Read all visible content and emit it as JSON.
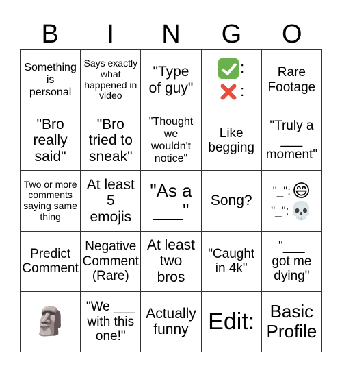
{
  "header": {
    "letters": [
      "B",
      "I",
      "N",
      "G",
      "O"
    ]
  },
  "board": {
    "rows": [
      [
        {
          "text": "Something\nis\npersonal"
        },
        {
          "text": "Says exactly\nwhat\nhappened in\nvideo"
        },
        {
          "text": "\"Type\nof guy\""
        },
        {
          "icons": [
            "check-mark-emoji",
            "cross-mark-emoji"
          ],
          "suffix": ":"
        },
        {
          "text": "Rare\nFootage"
        }
      ],
      [
        {
          "text": "\"Bro\nreally\nsaid\""
        },
        {
          "text": "\"Bro\ntried to\nsneak\""
        },
        {
          "text": "\"Thought\nwe\nwouldn't\nnotice\""
        },
        {
          "text": "Like\nbegging"
        },
        {
          "text": "\"Truly a\n___\nmoment\""
        }
      ],
      [
        {
          "text": "Two or more\ncomments\nsaying same\nthing"
        },
        {
          "text": "At least\n5\nemojis"
        },
        {
          "text": "\"As a\n___\""
        },
        {
          "text": "Song?"
        },
        {
          "lines": [
            {
              "text": "\"_\":",
              "emoji": "😄"
            },
            {
              "text": "\"_\":",
              "emoji": "💀"
            }
          ]
        }
      ],
      [
        {
          "text": "Predict\nComment"
        },
        {
          "text": "Negative\nComment\n(Rare)"
        },
        {
          "text": "At least\ntwo\nbros"
        },
        {
          "text": "\"Caught\nin 4k\""
        },
        {
          "text": "\"___\ngot me\ndying\""
        }
      ],
      [
        {
          "emoji": "🗿"
        },
        {
          "text": "\"We ___\nwith this\none!\""
        },
        {
          "text": "Actually\nfunny"
        },
        {
          "text": "Edit:"
        },
        {
          "text": "Basic\nProfile"
        }
      ]
    ]
  }
}
